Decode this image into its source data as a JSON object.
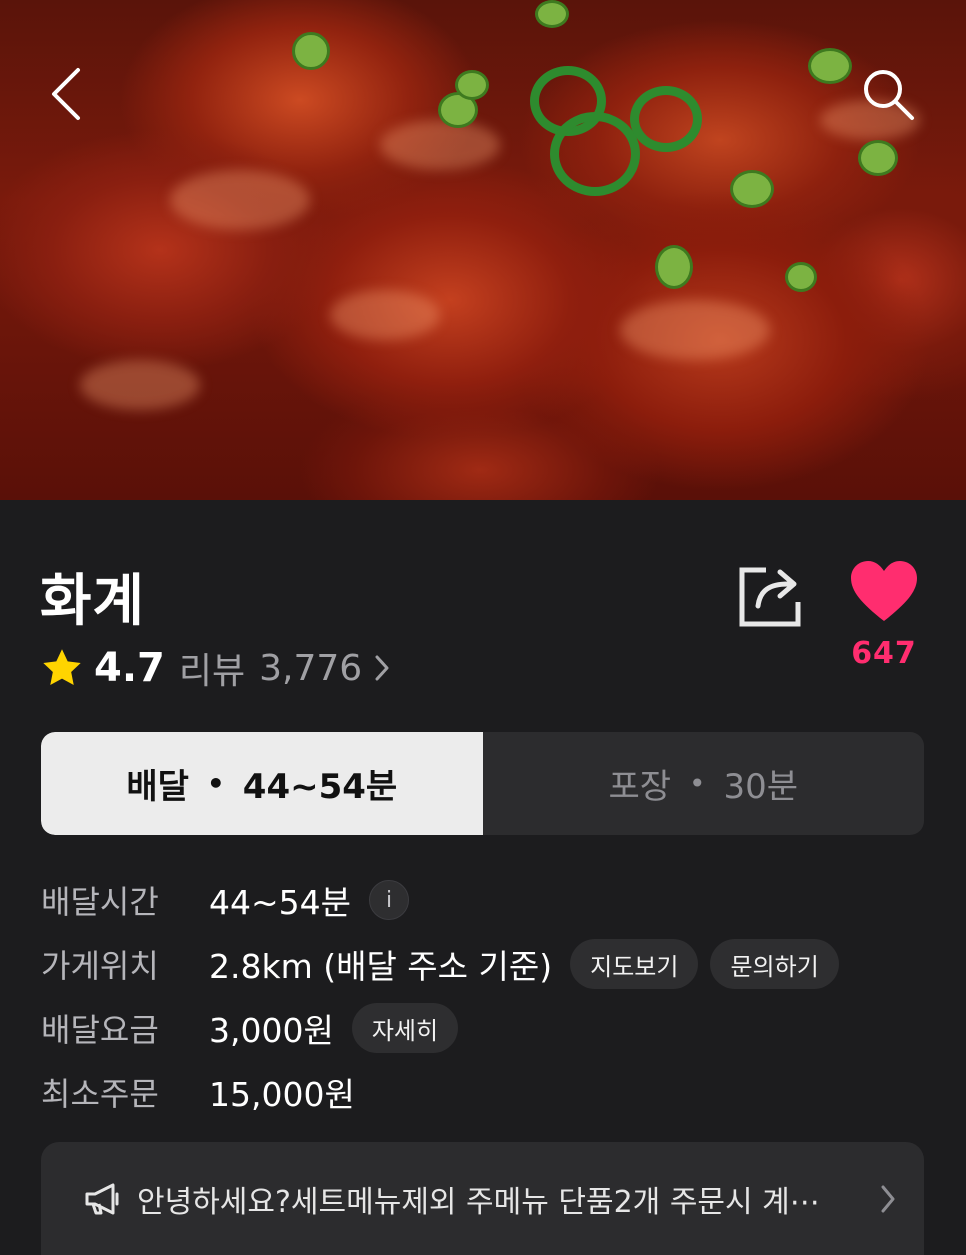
{
  "header": {
    "back_icon": "chevron-left-icon",
    "search_icon": "search-icon"
  },
  "store": {
    "name": "화계",
    "rating": "4.7",
    "review_label": "리뷰",
    "review_count": "3,776",
    "like_count": "647",
    "colors": {
      "accent": "#ff2d6f",
      "star": "#ffd400"
    }
  },
  "tabs": [
    {
      "label": "배달",
      "time": "44~54분",
      "active": true
    },
    {
      "label": "포장",
      "time": "30분",
      "active": false
    }
  ],
  "info": {
    "delivery_time": {
      "label": "배달시간",
      "value": "44~54분"
    },
    "location": {
      "label": "가게위치",
      "value": "2.8km (배달 주소 기준)",
      "map_button": "지도보기",
      "inquiry_button": "문의하기"
    },
    "delivery_fee": {
      "label": "배달요금",
      "value": "3,000원",
      "detail_button": "자세히"
    },
    "min_order": {
      "label": "최소주문",
      "value": "15,000원"
    }
  },
  "notice": {
    "text": "안녕하세요?세트메뉴제외 주메뉴 단품2개 주문시 계⋯"
  }
}
